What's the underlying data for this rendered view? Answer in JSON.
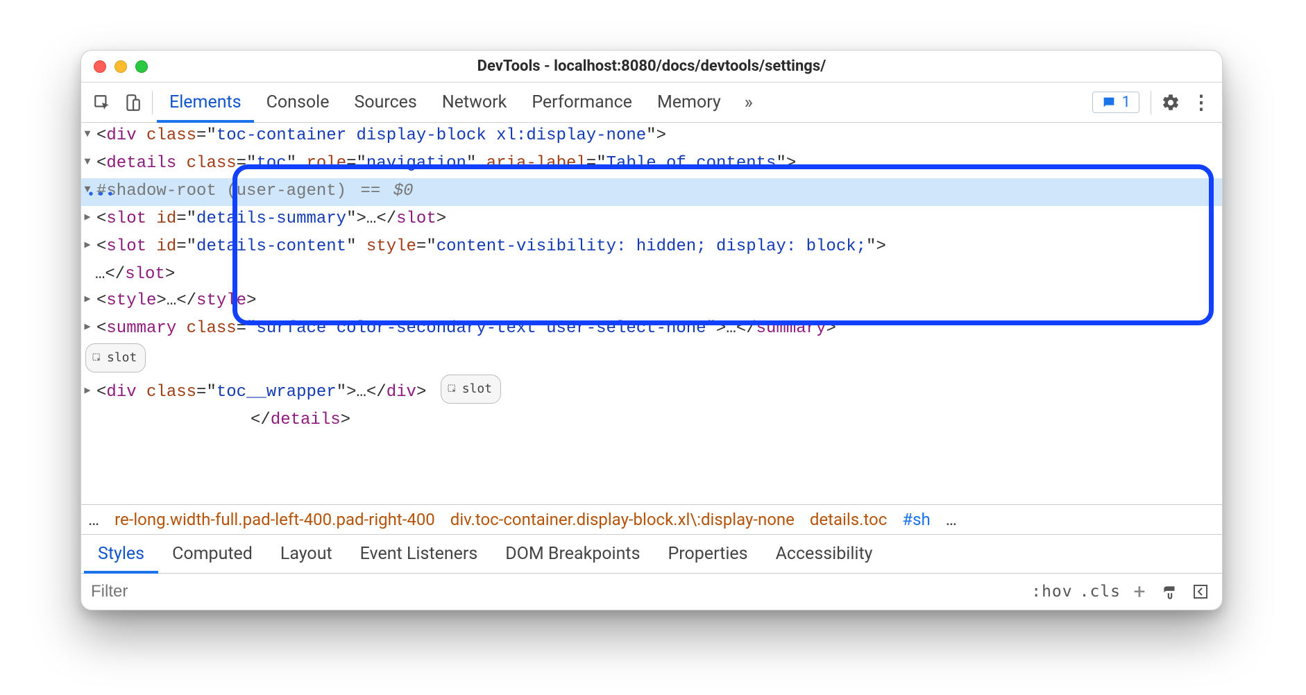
{
  "window": {
    "title": "DevTools - localhost:8080/docs/devtools/settings/"
  },
  "toolbar": {
    "panels": [
      "Elements",
      "Console",
      "Sources",
      "Network",
      "Performance",
      "Memory"
    ],
    "active_panel_index": 0,
    "issues_count": "1"
  },
  "dom": {
    "gutter_ellipsis": "•••",
    "selected_marker": "== $0",
    "lines": {
      "l0_tag": "div",
      "l0_class": "toc-container display-block xl:display-none",
      "l1_tag": "details",
      "l1_attrs_text": "class=\"toc\" role=\"navigation\" aria-label=\"Table of contents\"",
      "l2_text": "#shadow-root (user-agent)",
      "l3_tag": "slot",
      "l3_attr_name": "id",
      "l3_attr_val": "details-summary",
      "l4_tag": "slot",
      "l4_attr1_name": "id",
      "l4_attr1_val": "details-content",
      "l4_attr2_name": "style",
      "l4_attr2_val": "content-visibility: hidden; display: block;",
      "l5_tag": "style",
      "l6_tag": "summary",
      "l6_attr_name": "class",
      "l6_attr_val": "surface color-secondary-text user-select-none",
      "l7_badge": "slot",
      "l8_tag": "div",
      "l8_attr_name": "class",
      "l8_attr_val": "toc__wrapper",
      "l8_badge": "slot",
      "l9_close": "details"
    }
  },
  "breadcrumb": {
    "ell_left": "…",
    "items": [
      "re-long.width-full.pad-left-400.pad-right-400",
      "div.toc-container.display-block.xl\\:display-none",
      "details.toc",
      "#sh"
    ],
    "ell_right": "…"
  },
  "styles": {
    "tabs": [
      "Styles",
      "Computed",
      "Layout",
      "Event Listeners",
      "DOM Breakpoints",
      "Properties",
      "Accessibility"
    ],
    "active_index": 0,
    "filter_placeholder": "Filter",
    "hov_label": ":hov",
    "cls_label": ".cls"
  }
}
